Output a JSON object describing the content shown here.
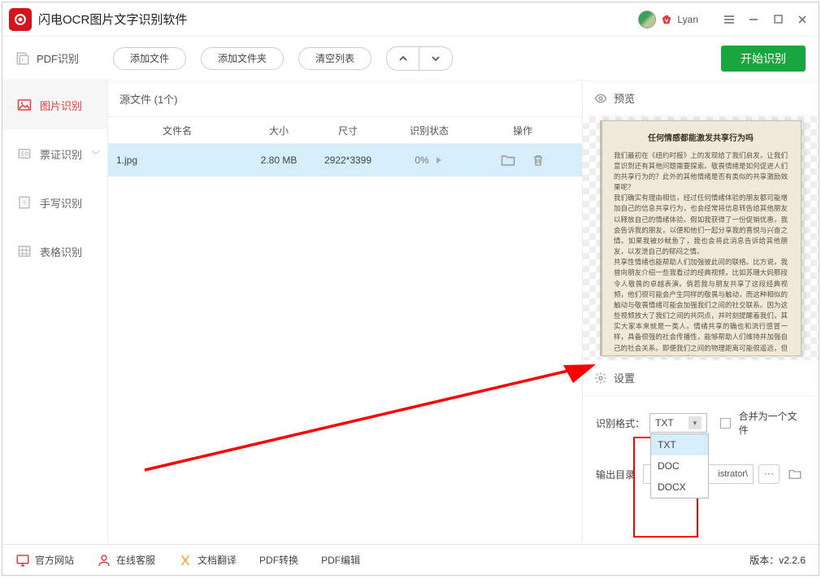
{
  "app": {
    "title": "闪电OCR图片文字识别软件",
    "username": "Lyan"
  },
  "sidebar": {
    "items": [
      {
        "label": "PDF识别"
      },
      {
        "label": "图片识别"
      },
      {
        "label": "票证识别"
      },
      {
        "label": "手写识别"
      },
      {
        "label": "表格识别"
      }
    ]
  },
  "toolbar": {
    "add_file": "添加文件",
    "add_folder": "添加文件夹",
    "clear_list": "清空列表",
    "start": "开始识别"
  },
  "files": {
    "section_title": "源文件 (1个)",
    "headers": {
      "name": "文件名",
      "size": "大小",
      "dim": "尺寸",
      "status": "识别状态",
      "op": "操作"
    },
    "rows": [
      {
        "name": "1.jpg",
        "size": "2.80 MB",
        "dim": "2922*3399",
        "progress": "0%"
      }
    ]
  },
  "preview": {
    "title": "预览",
    "page_title": "任何情感都能激发共享行为吗",
    "page_body": "我们最初在《纽约时报》上的发现给了我们启发，让我们意识到还有其他问题需要探索。敬畏情绪是如何促进人们的共享行为的？此外的其他情绪是否有类似的共享激励效果呢？\n我们确实有理由相信，经过任何情绪体验的朋友都可能增加自己的信息共享行为，也会经常将信息转告给其他朋友以释放自己的情绪体验。假如我获得了一份促销优惠，我会告诉我的朋友，以便和他们一起分享我的喜悦与兴奋之情。如果我被炒鱿鱼了，我也会将此消息告诉给其他朋友，以发泄自己的郁闷之情。\n共享性情绪也能帮助人们加强彼此间的联络。比方说，我曾向朋友介绍一些我看过的经典视频，比如苏珊大妈那段令人敬畏的卓越表演。倘若我与朋友共享了这段经典视频，他们很可能会产生同样的敬畏与触动，而这种相似的触动与敬畏情绪可能会加强我们之间的社交联系。因为这些视频放大了我们之间的共同点，并时刻提醒着我们，其实大家本来就是一类人。情绪共享的确也和流行感冒一样，具备很强的社会传播性，能够帮助人们维持并加强自己的社会关系。即便我们之间的物理距离可能很遥远，但我们之间的情绪感知却近在咫尺。"
  },
  "settings": {
    "title": "设置",
    "format_label": "识别格式：",
    "format_value": "TXT",
    "format_options": [
      "TXT",
      "DOC",
      "DOCX"
    ],
    "merge_label": "合并为一个文件",
    "output_label": "输出目录",
    "output_path": "istrator\\"
  },
  "footer": {
    "site": "官方网站",
    "support": "在线客服",
    "translate": "文档翻译",
    "pdf_convert": "PDF转换",
    "pdf_edit": "PDF编辑",
    "version": "版本：v2.2.6"
  }
}
